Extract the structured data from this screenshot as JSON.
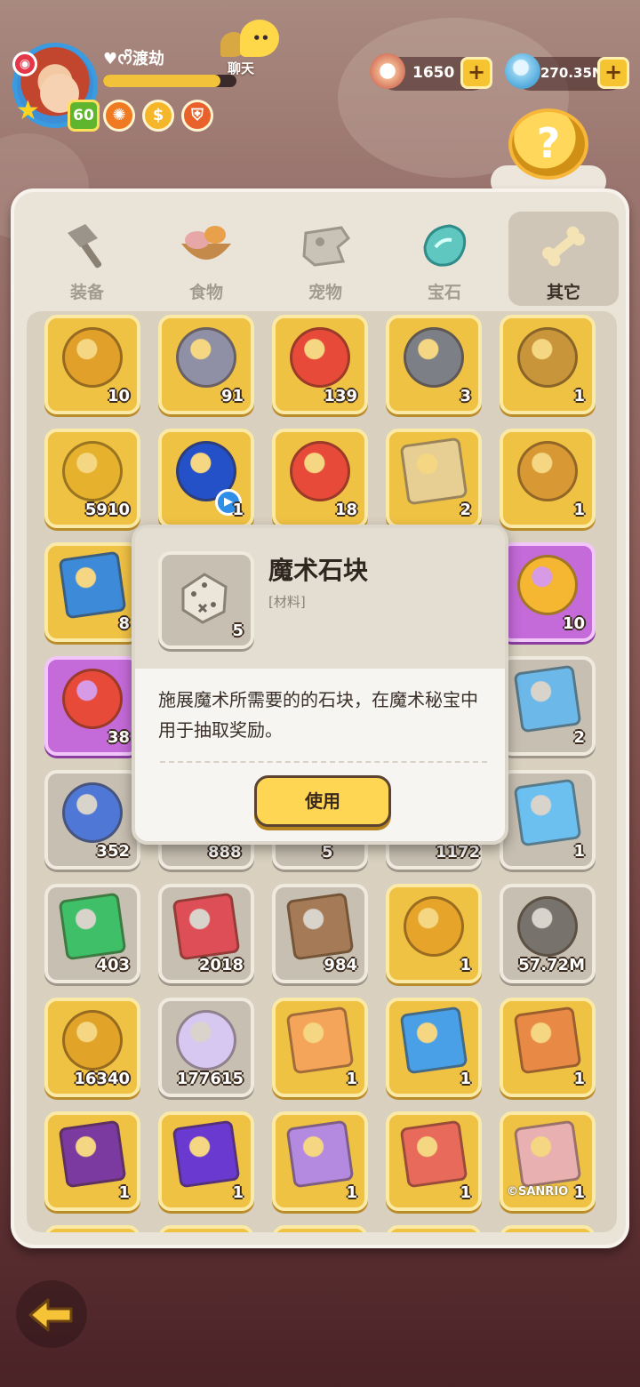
{
  "player": {
    "name": "♥ᰔᩚ渡劫",
    "level": "60",
    "xp_fraction": 0.88,
    "status_icons": [
      "fire-medal-icon",
      "coin-medal-icon",
      "shield-medal-icon"
    ]
  },
  "chat": {
    "label": "聊天"
  },
  "currencies": [
    {
      "name": "pearl",
      "value": "1650"
    },
    {
      "name": "crystal",
      "value": "270.35M"
    }
  ],
  "tabs": [
    {
      "label": "装备",
      "icon": "hammer-icon",
      "active": false
    },
    {
      "label": "食物",
      "icon": "food-bowl-icon",
      "active": false
    },
    {
      "label": "宠物",
      "icon": "pet-skull-icon",
      "active": false
    },
    {
      "label": "宝石",
      "icon": "gem-icon",
      "active": false
    },
    {
      "label": "其它",
      "icon": "bone-icon",
      "active": true
    }
  ],
  "items": [
    [
      {
        "icon": "gold-coin-icon",
        "count": "10",
        "bg": "gold"
      },
      {
        "icon": "silver-chest-icon",
        "count": "91",
        "bg": "gold"
      },
      {
        "icon": "horned-chest-icon",
        "count": "139",
        "bg": "gold"
      },
      {
        "icon": "magnifier-stone-icon",
        "count": "3",
        "bg": "gold"
      },
      {
        "icon": "rune-tablet-icon",
        "count": "1",
        "bg": "gold"
      }
    ],
    [
      {
        "icon": "swirl-coin-icon",
        "count": "5910",
        "bg": "gold"
      },
      {
        "icon": "blue-hero-orb-icon",
        "count": "1",
        "bg": "gold"
      },
      {
        "icon": "horned-chest-icon",
        "count": "18",
        "bg": "gold"
      },
      {
        "icon": "map-scroll-icon",
        "count": "2",
        "bg": "gold"
      },
      {
        "icon": "medal-icon",
        "count": "1",
        "bg": "gold"
      }
    ],
    [
      {
        "icon": "blue-ticket-icon",
        "count": "8",
        "bg": "gold"
      },
      {
        "icon": "",
        "count": "",
        "bg": "gold"
      },
      {
        "icon": "",
        "count": "",
        "bg": "gold"
      },
      {
        "icon": "",
        "count": "",
        "bg": "gold"
      },
      {
        "icon": "star-badge-icon",
        "count": "10",
        "bg": "purple"
      }
    ],
    [
      {
        "icon": "horned-chest-icon",
        "count": "38",
        "bg": "purple"
      },
      {
        "icon": "",
        "count": "",
        "bg": "gray"
      },
      {
        "icon": "",
        "count": "",
        "bg": "gray"
      },
      {
        "icon": "",
        "count": "",
        "bg": "gray"
      },
      {
        "icon": "spirit-card-icon",
        "count": "2",
        "bg": "gray"
      }
    ],
    [
      {
        "icon": "blue-crystal-icon",
        "count": "352",
        "bg": "gray"
      },
      {
        "icon": "",
        "count": "",
        "bg": "gray"
      },
      {
        "icon": "",
        "count": "",
        "bg": "gray"
      },
      {
        "icon": "",
        "count": "",
        "bg": "gray"
      },
      {
        "icon": "blue-card-icon",
        "count": "1",
        "bg": "gray"
      }
    ],
    [
      {
        "icon": "green-ticket-icon",
        "count": "403",
        "bg": "gray"
      },
      {
        "icon": "red-ticket-icon",
        "count": "2018",
        "bg": "gray"
      },
      {
        "icon": "brown-ticket-icon",
        "count": "984",
        "bg": "gray"
      },
      {
        "icon": "shell-coin-icon",
        "count": "1",
        "bg": "gold"
      },
      {
        "icon": "swirl-stone-icon",
        "count": "57.72M",
        "bg": "gray"
      }
    ],
    [
      {
        "icon": "dragon-coin-icon",
        "count": "16340",
        "bg": "gold"
      },
      {
        "icon": "rainbow-crystal-icon",
        "count": "177615",
        "bg": "gray"
      },
      {
        "icon": "photo-card-icon",
        "count": "1",
        "bg": "gold"
      },
      {
        "icon": "sonic-photo-icon",
        "count": "1",
        "bg": "gold"
      },
      {
        "icon": "cowboy-photo-icon",
        "count": "1",
        "bg": "gold"
      }
    ],
    [
      {
        "icon": "neon-photo-icon",
        "count": "1",
        "bg": "gold"
      },
      {
        "icon": "purple-photo-icon",
        "count": "1",
        "bg": "gold"
      },
      {
        "icon": "party-photo-icon",
        "count": "1",
        "bg": "gold"
      },
      {
        "icon": "stamp-photo-icon",
        "count": "1",
        "bg": "gold"
      },
      {
        "icon": "sanrio-photo-icon",
        "count": "1",
        "bg": "gold",
        "watermark": "©SANRIO"
      }
    ]
  ],
  "partial_counts": {
    "r4c1": "888",
    "r4c2": "5",
    "r4c3": "1172"
  },
  "popup": {
    "title": "魔术石块",
    "type": "[材料]",
    "count": "5",
    "icon": "magic-dice-stone-icon",
    "description": "施展魔术所需要的的石块，在魔术秘宝中用于抽取奖励。",
    "use_button": "使用"
  },
  "colors": {
    "gold_slot": "#f0c244",
    "gray_slot": "#c7bfb1",
    "purple_slot": "#c46ad9",
    "accent": "#ffd554"
  }
}
